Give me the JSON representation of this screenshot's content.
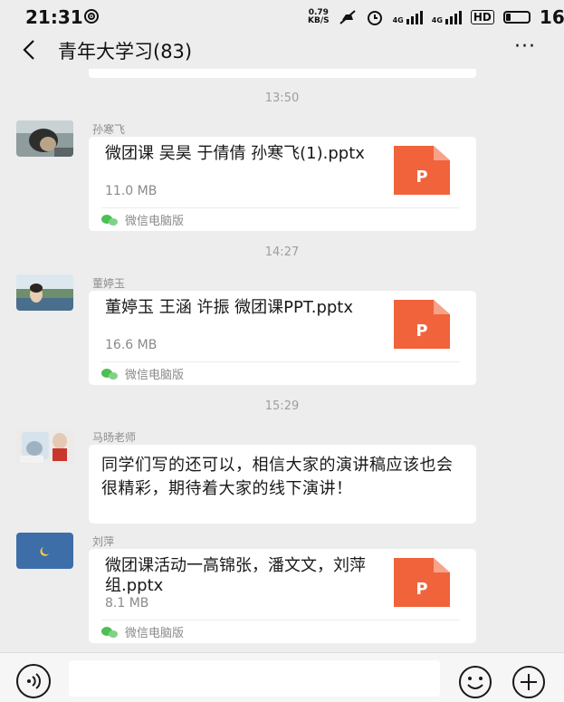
{
  "status_bar": {
    "time": "21:31",
    "net_speed_value": "0.79",
    "net_speed_unit": "KB/S",
    "sig1": "4G",
    "sig2": "4G",
    "hd": "HD",
    "battery": "16"
  },
  "header": {
    "title": "青年大学习(83)",
    "more": "···"
  },
  "messages": [
    {
      "time": "13:50",
      "sender": "孙寒飞",
      "file_name": "微团课 吴昊 于倩倩 孙寒飞(1).pptx",
      "file_size": "11.0 MB",
      "file_icon_letter": "P",
      "source": "微信电脑版"
    },
    {
      "time": "14:27",
      "sender": "董婷玉",
      "file_name": "董婷玉 王涵 许振 微团课PPT.pptx",
      "file_size": "16.6 MB",
      "file_icon_letter": "P",
      "source": "微信电脑版"
    },
    {
      "time": "15:29",
      "sender": "马旸老师",
      "text": "同学们写的还可以，相信大家的演讲稿应该也会很精彩，期待着大家的线下演讲！"
    },
    {
      "sender": "刘萍",
      "file_name": "微团课活动一高锦张，潘文文，刘萍组.pptx",
      "file_size": "8.1 MB",
      "file_icon_letter": "P",
      "source": "微信电脑版"
    }
  ],
  "input_bar": {
    "placeholder": ""
  },
  "colors": {
    "background": "#ededed",
    "ppt_orange": "#f0633b",
    "wechat_green": "#4dbf55"
  }
}
